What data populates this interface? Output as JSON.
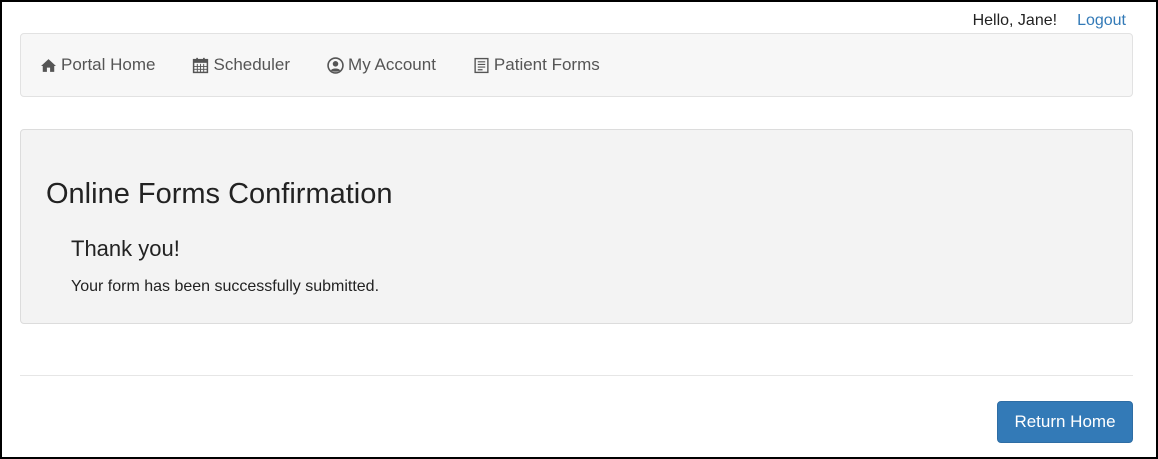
{
  "header": {
    "greeting": "Hello, Jane!",
    "logout_label": "Logout"
  },
  "nav": {
    "items": [
      {
        "label": "Portal Home",
        "icon": "home-icon"
      },
      {
        "label": "Scheduler",
        "icon": "calendar-icon"
      },
      {
        "label": "My Account",
        "icon": "user-circle-icon"
      },
      {
        "label": "Patient Forms",
        "icon": "form-icon"
      }
    ]
  },
  "confirmation": {
    "title": "Online Forms Confirmation",
    "subtitle": "Thank you!",
    "message": "Your form has been successfully submitted."
  },
  "actions": {
    "return_label": "Return Home"
  },
  "colors": {
    "link": "#337ab7",
    "primary_button": "#337ab7",
    "nav_background": "#f7f7f7",
    "panel_background": "#f3f3f3"
  }
}
